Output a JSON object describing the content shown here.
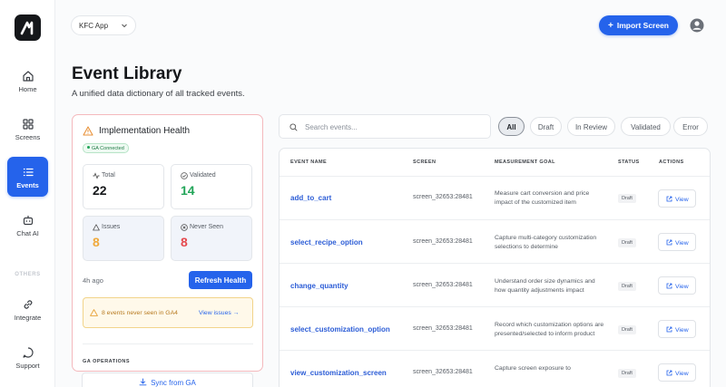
{
  "sidebar": {
    "items": [
      {
        "label": "Home",
        "icon": "home-icon"
      },
      {
        "label": "Screens",
        "icon": "grid-icon"
      },
      {
        "label": "Events",
        "icon": "list-icon",
        "active": true
      },
      {
        "label": "Chat AI",
        "icon": "bot-icon"
      },
      {
        "label": "Integrate",
        "icon": "link-icon"
      },
      {
        "label": "Support",
        "icon": "chat-bubble-icon"
      }
    ],
    "group_label": "OTHERS"
  },
  "header": {
    "app_select": "KFC App",
    "import_button": "Import Screen"
  },
  "page": {
    "title": "Event Library",
    "subtitle": "A unified data dictionary of all tracked events."
  },
  "health": {
    "title": "Implementation Health",
    "badge": "GA Connected",
    "stats": {
      "total": {
        "label": "Total",
        "value": "22"
      },
      "validated": {
        "label": "Validated",
        "value": "14"
      },
      "issues": {
        "label": "Issues",
        "value": "8"
      },
      "never_seen": {
        "label": "Never Seen",
        "value": "8"
      }
    },
    "last_refresh": "4h ago",
    "refresh_button": "Refresh Health",
    "alert_text": "8 events never seen in GA4",
    "alert_link": "View issues →",
    "ops_label": "GA OPERATIONS",
    "sync_button": "Sync from GA"
  },
  "search": {
    "placeholder": "Search events..."
  },
  "filters": [
    "All",
    "Draft",
    "In Review",
    "Validated",
    "Error"
  ],
  "table": {
    "headers": {
      "name": "EVENT NAME",
      "screen": "SCREEN",
      "goal": "MEASUREMENT GOAL",
      "status": "STATUS",
      "actions": "ACTIONS"
    },
    "rows": [
      {
        "name": "add_to_cart",
        "screen": "screen_32653:28481",
        "goal": "Measure cart conversion and price impact of the customized item",
        "status": "Draft",
        "action": "View"
      },
      {
        "name": "select_recipe_option",
        "screen": "screen_32653:28481",
        "goal": "Capture multi-category customization selections to determine",
        "status": "Draft",
        "action": "View"
      },
      {
        "name": "change_quantity",
        "screen": "screen_32653:28481",
        "goal": "Understand order size dynamics and how quantity adjustments impact",
        "status": "Draft",
        "action": "View"
      },
      {
        "name": "select_customization_option",
        "screen": "screen_32653:28481",
        "goal": "Record which customization options are presented/selected to inform product",
        "status": "Draft",
        "action": "View"
      },
      {
        "name": "view_customization_screen",
        "screen": "screen_32653:28481",
        "goal": "Capture screen exposure to",
        "status": "Draft",
        "action": "View"
      }
    ]
  },
  "colors": {
    "accent": "#2563eb",
    "validated": "#22a559",
    "issues": "#f0a93b",
    "never_seen": "#e5484d"
  }
}
